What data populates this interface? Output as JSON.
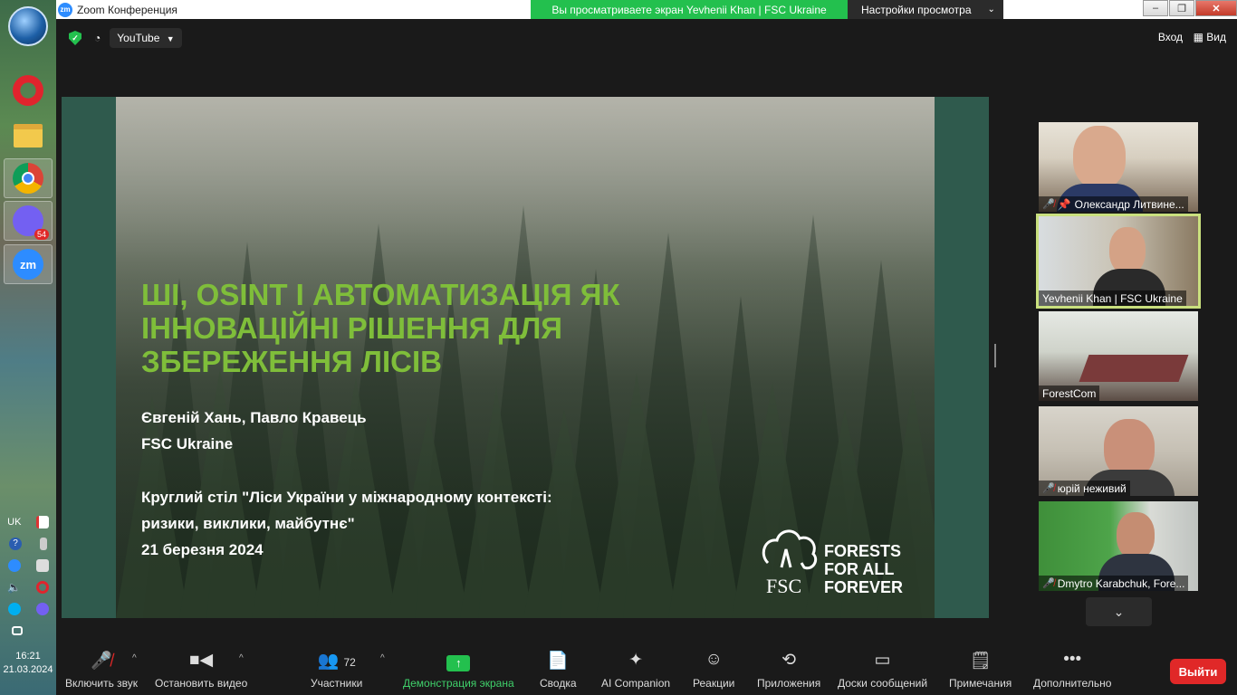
{
  "taskbar": {
    "apps": [
      "start-orb",
      "opera",
      "file-explorer",
      "chrome",
      "viber",
      "zoom"
    ],
    "viber_badge": "54",
    "tray": {
      "lang": "UK"
    },
    "clock": {
      "time": "16:21",
      "date": "21.03.2024"
    }
  },
  "window": {
    "title": "Zoom Конференция",
    "share_banner": "Вы просматриваете экран Yevhenii Khan | FSC Ukraine",
    "view_settings": "Настройки просмотра"
  },
  "topbar": {
    "source": "YouTube",
    "login": "Вход",
    "view": "Вид"
  },
  "slide": {
    "heading": [
      "ШІ, OSINT І АВТОМАТИЗАЦІЯ ЯК",
      "ІННОВАЦІЙНІ РІШЕННЯ ДЛЯ",
      "ЗБЕРЕЖЕННЯ ЛІСІВ"
    ],
    "authors": "Євгеній Хань, Павло Кравець",
    "org": "FSC Ukraine",
    "event_line1": "Круглий стіл \"Ліси України у міжнародному контексті:",
    "event_line2": "ризики, виклики, майбутнє\"",
    "date": "21 березня 2024",
    "logo_text": [
      "FORESTS",
      "FOR ALL",
      "FOREVER"
    ],
    "logo_mark": "FSC"
  },
  "participants": [
    {
      "name": "Олександр Литвине...",
      "muted": true,
      "speaking": false
    },
    {
      "name": "Yevhenii Khan | FSC Ukraine",
      "muted": false,
      "speaking": true
    },
    {
      "name": "ForestCom",
      "muted": false,
      "speaking": false
    },
    {
      "name": "юрій неживий",
      "muted": true,
      "speaking": false
    },
    {
      "name": "Dmytro Karabchuk, Fore...",
      "muted": true,
      "speaking": false
    }
  ],
  "controls": {
    "audio": "Включить звук",
    "video": "Остановить видео",
    "participants": "Участники",
    "participants_count": "72",
    "share": "Демонстрация экрана",
    "summary": "Сводка",
    "ai": "AI Companion",
    "reactions": "Реакции",
    "apps": "Приложения",
    "whiteboards": "Доски сообщений",
    "notes": "Примечания",
    "more": "Дополнительно",
    "leave": "Выйти"
  },
  "colors": {
    "share_green": "#23c04e",
    "slide_green": "#7fbe3a",
    "leave_red": "#e02828",
    "active_outline": "#c9e07e"
  }
}
